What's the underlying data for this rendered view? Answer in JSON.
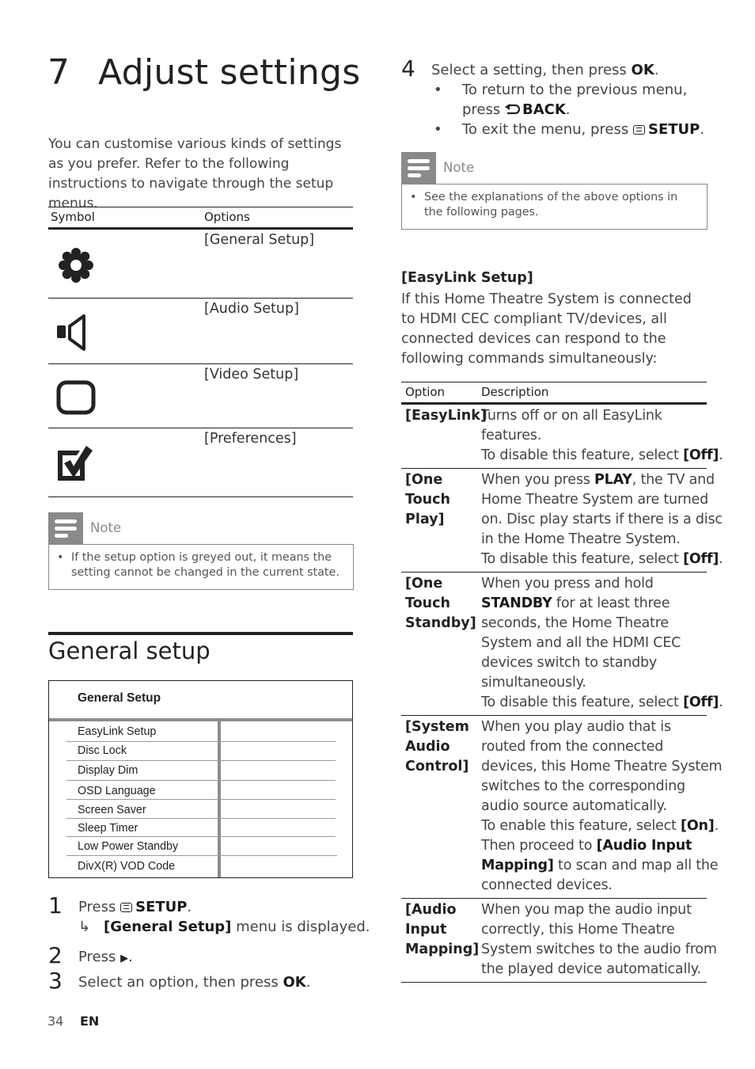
{
  "chapter": {
    "number": "7",
    "title": "Adjust settings",
    "intro": "You can customise various kinds of settings as you prefer. Refer to the following instructions to navigate through the setup menus."
  },
  "symbol_table": {
    "headers": [
      "Symbol",
      "Options"
    ],
    "rows": [
      {
        "icon": "gear-icon",
        "option": "[General Setup]"
      },
      {
        "icon": "speaker-icon",
        "option": "[Audio Setup]"
      },
      {
        "icon": "screen-icon",
        "option": "[Video Setup]"
      },
      {
        "icon": "checkbox-icon",
        "option": "[Preferences]"
      }
    ]
  },
  "note_left": {
    "label": "Note",
    "bullet": "•",
    "text_lines": [
      "If the setup option is greyed out, it means the",
      "setting cannot be changed in the current state."
    ]
  },
  "general_setup": {
    "heading": "General setup",
    "menu_title": "General Setup",
    "menu_items": [
      "EasyLink Setup",
      "Disc Lock",
      "Display Dim",
      "OSD Language",
      "Screen Saver",
      "Sleep Timer",
      "Low Power Standby",
      "DivX(R) VOD Code"
    ]
  },
  "steps": [
    {
      "num": "1",
      "pre": "Press ",
      "icon": "setup-key-icon",
      "key": "SETUP",
      "post": ".",
      "result_arrow": "↳",
      "result_bold": "[General Setup]",
      "result_text": " menu is displayed."
    },
    {
      "num": "2",
      "pre": "Press ",
      "key_glyph": "▶",
      "post": "."
    },
    {
      "num": "3",
      "pre": "Select an option, then press ",
      "key": "OK",
      "post": "."
    },
    {
      "num": "4",
      "pre": "Select a setting, then press ",
      "key": "OK",
      "post": "."
    }
  ],
  "step4_bullets": [
    {
      "bullet": "•",
      "line1": "To return to the previous menu,",
      "pre": "press ",
      "icon": "back-icon",
      "key": "BACK",
      "post": "."
    },
    {
      "bullet": "•",
      "pre": "To exit the menu, press ",
      "icon": "setup-key-icon",
      "key": "SETUP",
      "post": "."
    }
  ],
  "note_right": {
    "label": "Note",
    "bullet": "•",
    "text_lines": [
      "See the explanations of the above options in",
      "the following pages."
    ]
  },
  "easylink": {
    "heading": "[EasyLink Setup]",
    "intro_lines": [
      "If this Home Theatre System is connected",
      "to HDMI CEC compliant TV/devices, all",
      "connected devices can respond to the",
      "following commands simultaneously:"
    ],
    "headers": [
      "Option",
      "Description"
    ],
    "rows": [
      {
        "name_lines": [
          "[EasyLink]"
        ],
        "desc_lines": [
          [
            {
              "t": "Turns off or on all EasyLink"
            }
          ],
          [
            {
              "t": "features."
            }
          ],
          [
            {
              "t": "To disable this feature, select "
            },
            {
              "b": "[Off]"
            },
            {
              "t": "."
            }
          ]
        ]
      },
      {
        "name_lines": [
          "[One",
          "Touch",
          "Play]"
        ],
        "desc_lines": [
          [
            {
              "t": "When you press "
            },
            {
              "b": "PLAY"
            },
            {
              "t": ", the TV and"
            }
          ],
          [
            {
              "t": "Home Theatre System are turned"
            }
          ],
          [
            {
              "t": "on. Disc play starts if there is a disc"
            }
          ],
          [
            {
              "t": "in the Home Theatre System."
            }
          ],
          [
            {
              "t": "To disable this feature, select "
            },
            {
              "b": "[Off]"
            },
            {
              "t": "."
            }
          ]
        ]
      },
      {
        "name_lines": [
          "[One",
          "Touch",
          "Standby]"
        ],
        "desc_lines": [
          [
            {
              "t": "When you press and hold"
            }
          ],
          [
            {
              "b": "STANDBY"
            },
            {
              "t": " for at least three"
            }
          ],
          [
            {
              "t": "seconds, the Home Theatre"
            }
          ],
          [
            {
              "t": "System and all the HDMI CEC"
            }
          ],
          [
            {
              "t": "devices switch to standby"
            }
          ],
          [
            {
              "t": "simultaneously."
            }
          ],
          [
            {
              "t": "To disable this feature, select "
            },
            {
              "b": "[Off]"
            },
            {
              "t": "."
            }
          ]
        ]
      },
      {
        "name_lines": [
          "[System",
          "Audio",
          "Control]"
        ],
        "desc_lines": [
          [
            {
              "t": "When you play audio that is"
            }
          ],
          [
            {
              "t": "routed from the connected"
            }
          ],
          [
            {
              "t": "devices, this Home Theatre System"
            }
          ],
          [
            {
              "t": "switches to the corresponding"
            }
          ],
          [
            {
              "t": "audio source automatically."
            }
          ],
          [
            {
              "t": "To enable this feature, select "
            },
            {
              "b": "[On]"
            },
            {
              "t": "."
            }
          ],
          [
            {
              "t": "Then proceed to "
            },
            {
              "b": "[Audio Input"
            }
          ],
          [
            {
              "b": "Mapping]"
            },
            {
              "t": " to scan and map all the"
            }
          ],
          [
            {
              "t": "connected devices."
            }
          ]
        ]
      },
      {
        "name_lines": [
          "[Audio",
          "Input",
          "Mapping]"
        ],
        "desc_lines": [
          [
            {
              "t": "When you map the audio input"
            }
          ],
          [
            {
              "t": "correctly, this Home Theatre"
            }
          ],
          [
            {
              "t": "System switches to the audio from"
            }
          ],
          [
            {
              "t": "the played device automatically."
            }
          ]
        ]
      }
    ]
  },
  "footer": {
    "page_number": "34",
    "language": "EN"
  }
}
